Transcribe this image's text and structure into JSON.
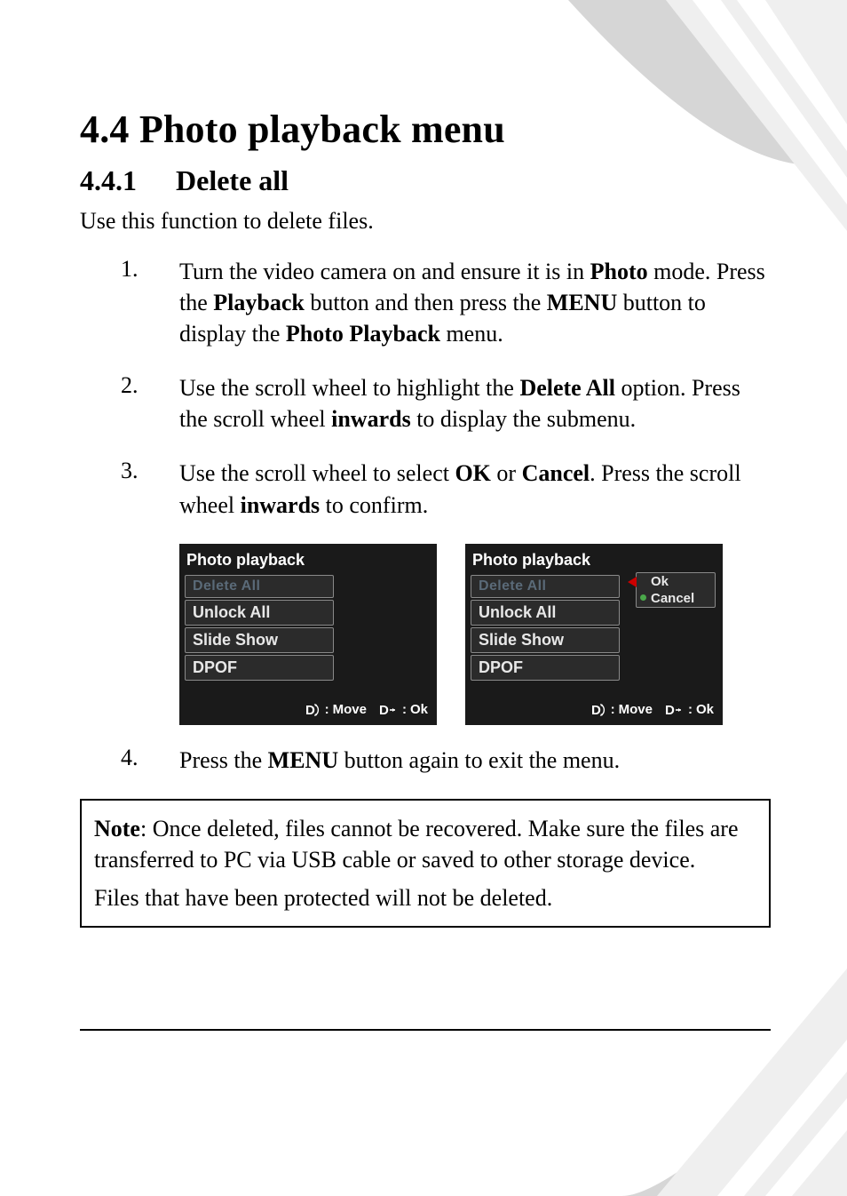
{
  "section": {
    "number": "4.4",
    "title": "Photo playback menu"
  },
  "subsection": {
    "number": "4.4.1",
    "title": "Delete all"
  },
  "lead": "Use this function to delete files.",
  "steps": [
    {
      "num": "1.",
      "html": "Turn the video camera on and ensure it is in <b>Photo</b> mode. Press the <b>Playback</b> button and then press the <b>MENU</b> button to display the <b>Photo Playback</b> menu."
    },
    {
      "num": "2.",
      "html": "Use the scroll wheel to highlight the <b>Delete All</b> option. Press the scroll wheel <b>inwards</b> to display the submenu."
    },
    {
      "num": "3.",
      "html": "Use the scroll wheel to select <b>OK</b> or <b>Cancel</b>. Press the scroll wheel <b>inwards</b> to confirm."
    },
    {
      "num": "4.",
      "html": "Press the <b>MENU</b> button again to exit the menu."
    }
  ],
  "screen": {
    "title": "Photo playback",
    "items": [
      "Delete All",
      "Unlock All",
      "Slide Show",
      "DPOF"
    ],
    "hint_move": "Move",
    "hint_ok": "Ok",
    "submenu": {
      "options": [
        "Ok",
        "Cancel"
      ],
      "selected": "Cancel"
    }
  },
  "note": {
    "label": "Note",
    "p1": ": Once deleted, files cannot be recovered. Make sure the files are transferred to PC via USB cable or saved to other storage device.",
    "p2": "Files that have been protected will not be deleted."
  }
}
